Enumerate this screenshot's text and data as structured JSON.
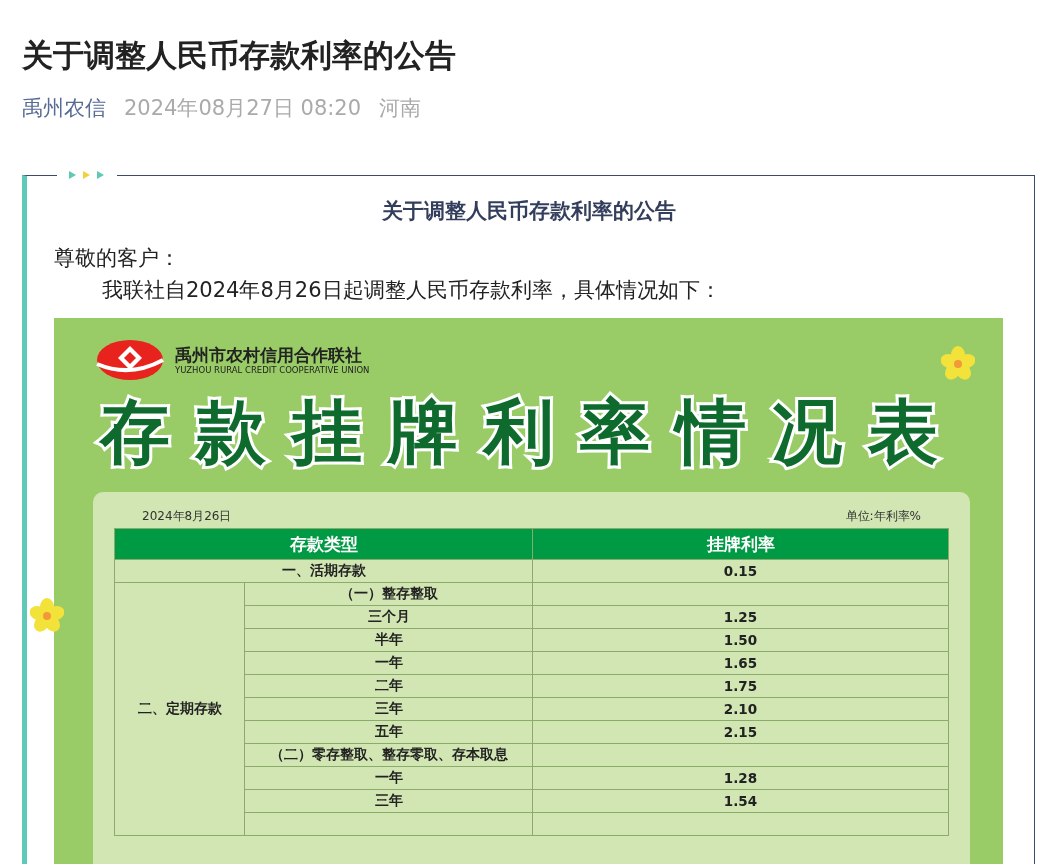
{
  "article": {
    "title": "关于调整人民币存款利率的公告",
    "source": "禹州农信",
    "date": "2024年08月27日 08:20",
    "region": "河南"
  },
  "notice": {
    "heading": "关于调整人民币存款利率的公告",
    "greeting": "尊敬的客户：",
    "body": "我联社自2024年8月26日起调整人民币存款利率，具体情况如下："
  },
  "poster": {
    "org_name": "禹州市农村信用合作联社",
    "org_name_en": "YUZHOU RURAL CREDIT COOPERATIVE  UNION",
    "title": "存款挂牌利率情况表",
    "date": "2024年8月26日",
    "unit": "单位:年利率%",
    "columns": [
      "存款类型",
      "挂牌利率"
    ],
    "rows": [
      {
        "kind": "single",
        "label": "一、活期存款",
        "rate": "0.15"
      },
      {
        "kind": "group",
        "label": "二、定期存款",
        "children": [
          {
            "kind": "subheading",
            "label": "（一）整存整取"
          },
          {
            "kind": "term",
            "label": "三个月",
            "rate": "1.25"
          },
          {
            "kind": "term",
            "label": "半年",
            "rate": "1.50"
          },
          {
            "kind": "term",
            "label": "一年",
            "rate": "1.65"
          },
          {
            "kind": "term",
            "label": "二年",
            "rate": "1.75"
          },
          {
            "kind": "term",
            "label": "三年",
            "rate": "2.10"
          },
          {
            "kind": "term",
            "label": "五年",
            "rate": "2.15"
          },
          {
            "kind": "subheading",
            "label": "（二）零存整取、整存零取、存本取息"
          },
          {
            "kind": "term",
            "label": "一年",
            "rate": "1.28"
          },
          {
            "kind": "term",
            "label": "三年",
            "rate": "1.54"
          }
        ]
      }
    ]
  }
}
